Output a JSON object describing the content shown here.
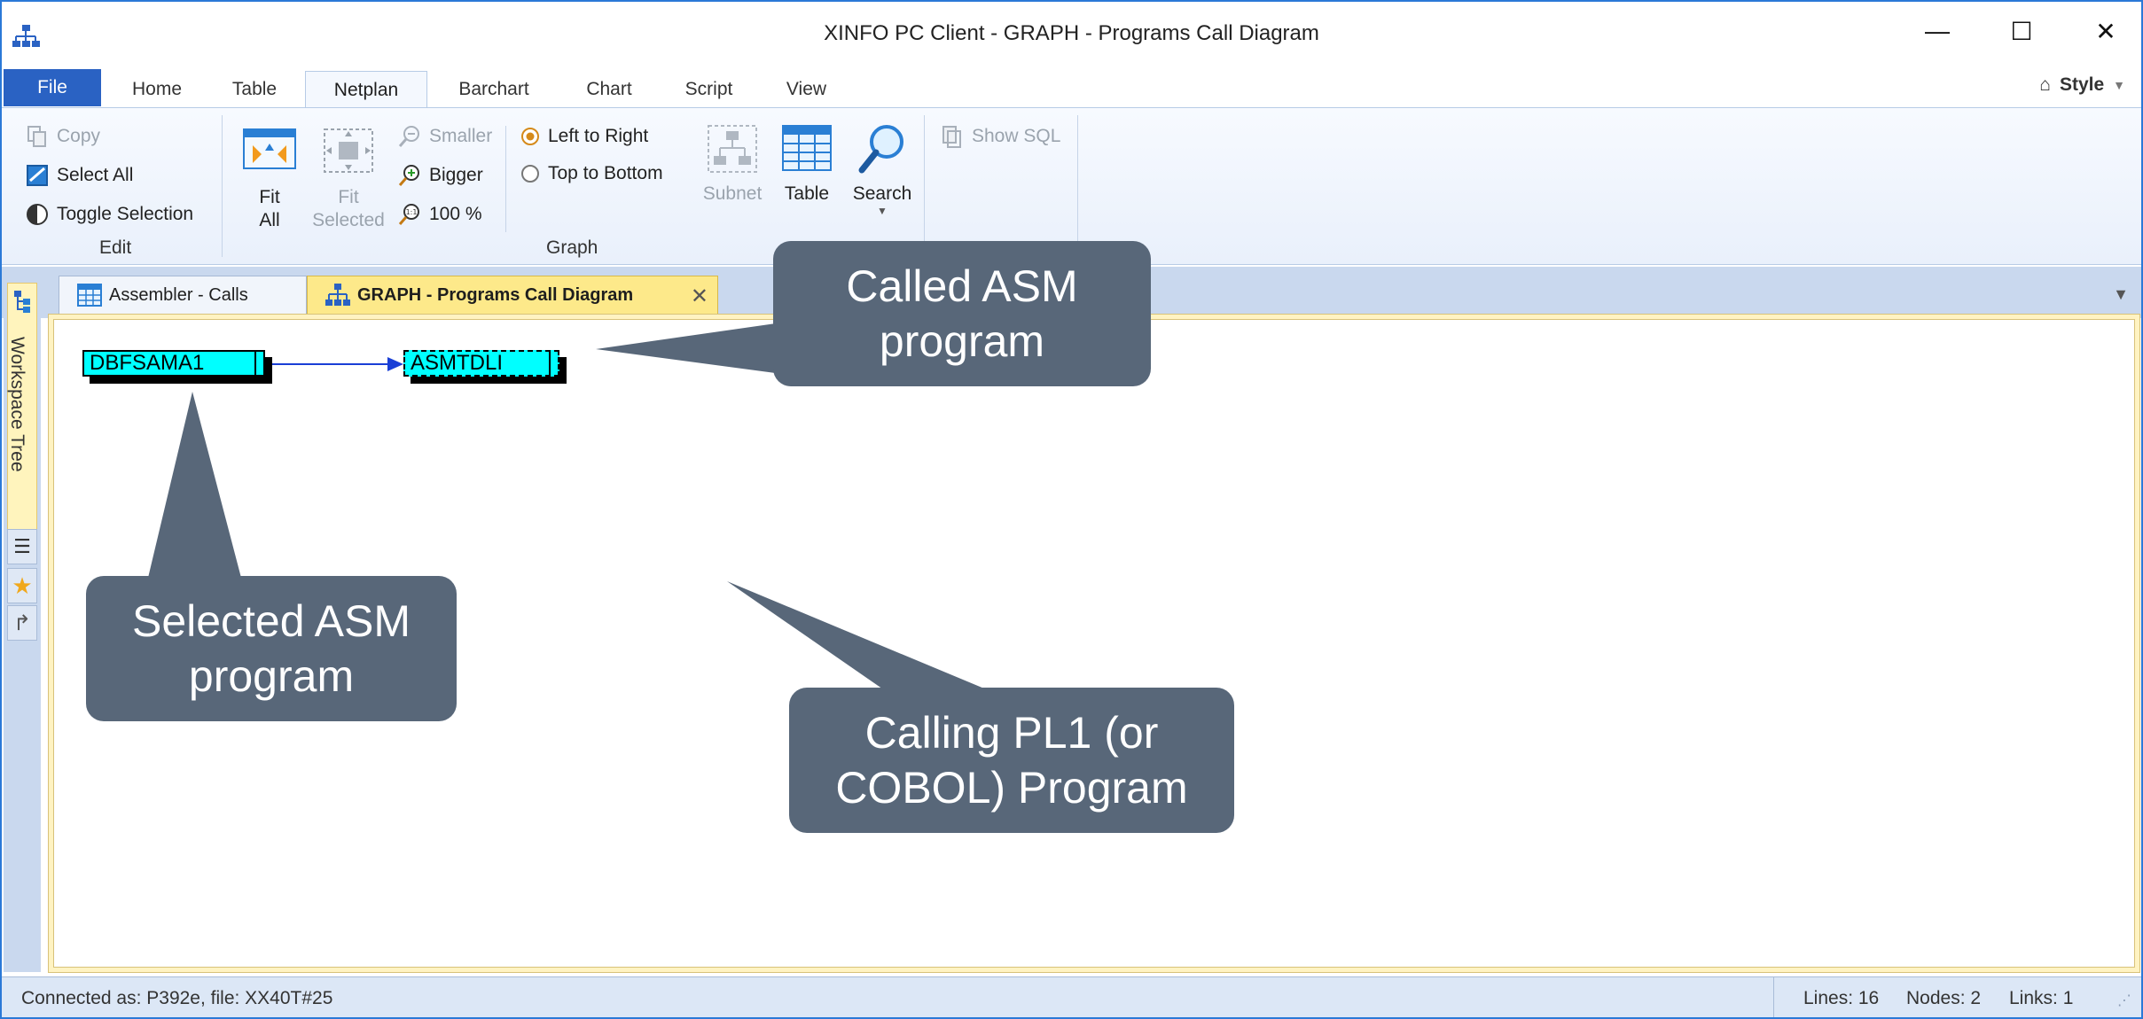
{
  "window": {
    "title": "XINFO PC Client - GRAPH - Programs Call Diagram",
    "minimize": "—",
    "maximize": "☐",
    "close": "✕"
  },
  "ribbon_tabs": {
    "file": "File",
    "items": [
      "Home",
      "Table",
      "Netplan",
      "Barchart",
      "Chart",
      "Script",
      "View"
    ],
    "active": "Netplan",
    "style_label": "Style"
  },
  "edit_group": {
    "label": "Edit",
    "copy": "Copy",
    "select_all": "Select All",
    "toggle_selection": "Toggle Selection"
  },
  "graph_group": {
    "label": "Graph",
    "fit_all": [
      "Fit",
      "All"
    ],
    "fit_selected": [
      "Fit",
      "Selected"
    ],
    "smaller": "Smaller",
    "bigger": "Bigger",
    "zoom": "100 %",
    "left_to_right": "Left to Right",
    "top_to_bottom": "Top to Bottom",
    "subnet": "Subnet",
    "table": "Table",
    "search": "Search",
    "show_sql": "Show SQL",
    "orientation_selected": "left_to_right"
  },
  "workspace": {
    "rail_label": "Workspace Tree"
  },
  "doc_tabs": [
    {
      "label": "Assembler - Calls",
      "active": false
    },
    {
      "label": "GRAPH - Programs Call Diagram",
      "active": true
    }
  ],
  "graph": {
    "nodes": [
      {
        "id": "DBFSAMA1",
        "selected": false
      },
      {
        "id": "ASMTDLI",
        "selected": true
      }
    ],
    "edges": [
      {
        "from": "DBFSAMA1",
        "to": "ASMTDLI"
      }
    ]
  },
  "callouts": {
    "called": [
      "Called ASM",
      "program"
    ],
    "selected": [
      "Selected ASM",
      "program"
    ],
    "calling": [
      "Calling PL1 (or",
      "COBOL) Program"
    ]
  },
  "status": {
    "connection": "Connected as: P392e, file: XX40T#25",
    "lines": "Lines: 16",
    "nodes": "Nodes: 2",
    "links": "Links: 1"
  },
  "colors": {
    "accent": "#2a62c3",
    "node_fill": "#00ffff",
    "callout": "#586779",
    "active_doc_tab": "#fde98a",
    "edge": "#1a3fd6"
  }
}
